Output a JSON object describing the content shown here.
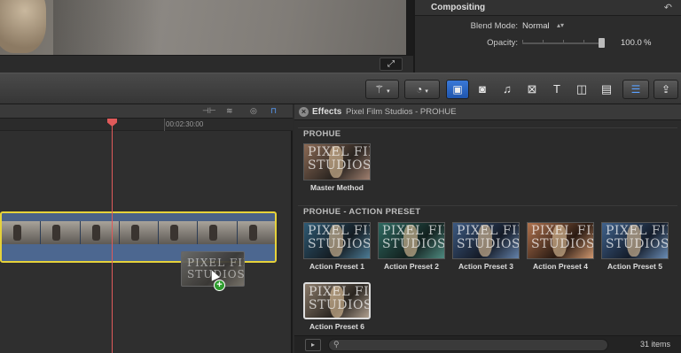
{
  "viewer": {
    "fullscreen_icon": "expand-arrows-icon"
  },
  "inspector": {
    "title": "Compositing",
    "reset_icon": "reset-arrow-icon",
    "blend_mode_label": "Blend Mode:",
    "blend_mode_value": "Normal",
    "opacity_label": "Opacity:",
    "opacity_value": "100.0",
    "opacity_unit": "%",
    "opacity_level": 1.0
  },
  "toolbar": {
    "tools": [
      "magic-wand-icon",
      "retime-speedometer-icon",
      "effects-browser-icon",
      "photos-icon",
      "music-icon",
      "transitions-icon",
      "titles-icon",
      "generators-icon",
      "themes-icon",
      "share-icon"
    ],
    "active_tool": "effects-browser-icon"
  },
  "timeline": {
    "timecode": "00:02:30:00",
    "drag_clip_text": "PIXEL FILM\nSTUDIOS"
  },
  "effects": {
    "title": "Effects",
    "subtitle": "Pixel Film Studios - PROHUE",
    "sections": [
      {
        "title": "PROHUE",
        "items": [
          {
            "name": "Master Method",
            "tint": "#8b6a55"
          }
        ]
      },
      {
        "title": "PROHUE - ACTION PRESET",
        "items": [
          {
            "name": "Action Preset 1",
            "tint": "#2f5a74"
          },
          {
            "name": "Action Preset 2",
            "tint": "#2f6a62"
          },
          {
            "name": "Action Preset 3",
            "tint": "#3d5a82"
          },
          {
            "name": "Action Preset 4",
            "tint": "#b0734f"
          },
          {
            "name": "Action Preset 5",
            "tint": "#40628c"
          },
          {
            "name": "Action Preset 6",
            "tint": "#8a7a6a"
          }
        ]
      }
    ],
    "thumb_text": "PIXEL FILM\nSTUDIOS",
    "item_count": "31 items"
  }
}
